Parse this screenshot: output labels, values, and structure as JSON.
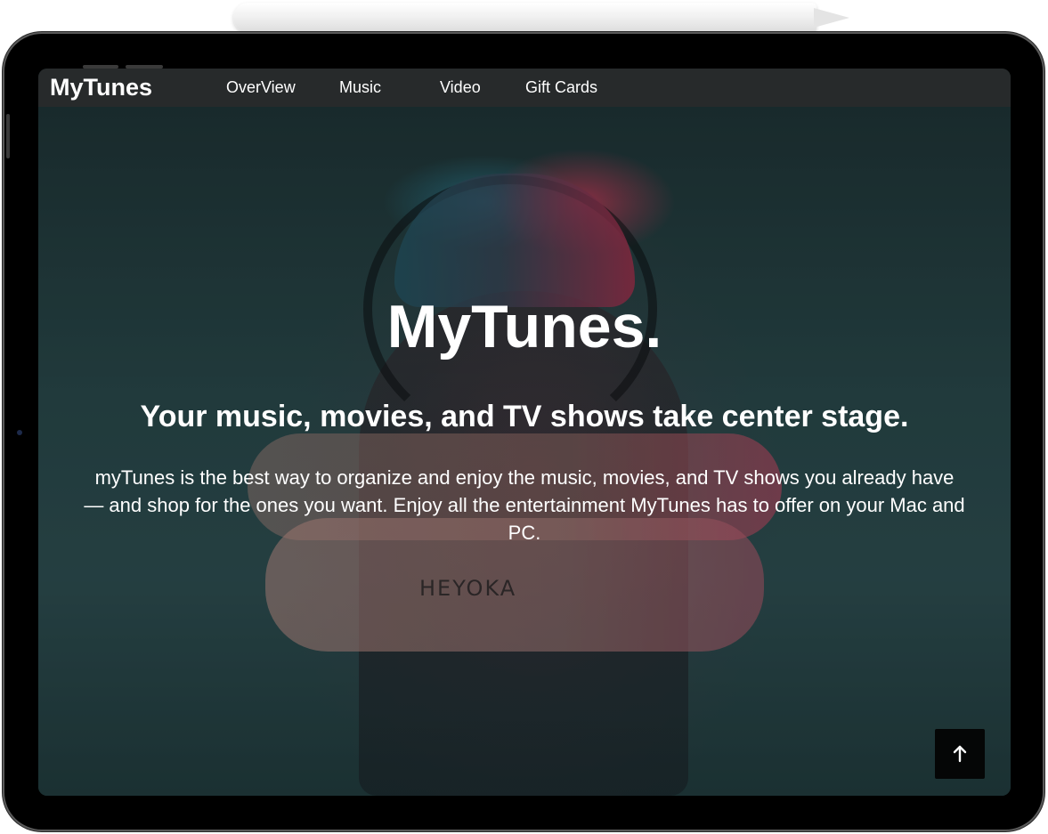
{
  "navbar": {
    "brand": "MyTunes",
    "items": [
      {
        "label": "OverView"
      },
      {
        "label": "Music"
      },
      {
        "label": "Video"
      },
      {
        "label": "Gift Cards"
      }
    ]
  },
  "hero": {
    "title": "MyTunes.",
    "subtitle": "Your music, movies, and TV shows take center stage.",
    "body": "myTunes is the best way to organize and enjoy the music, movies, and TV shows you already have — and shop for the ones you want. Enjoy all the entertainment MyTunes has to offer on your Mac and PC.",
    "image_tattoo_text": "HEYOKA"
  },
  "back_to_top": {
    "icon": "arrow-up-icon"
  },
  "colors": {
    "navbar_bg": "#272a2b",
    "text": "#ffffff",
    "back_to_top_bg": "#050606"
  }
}
